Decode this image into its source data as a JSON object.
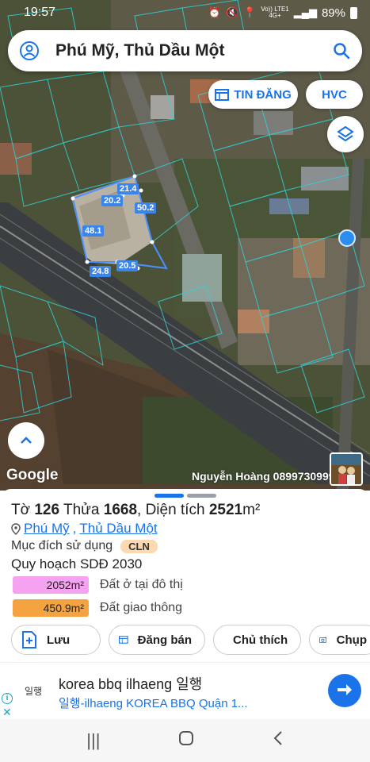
{
  "status_bar": {
    "time": "19:57",
    "network": "Vo)) LTE1",
    "signal": "4G+",
    "battery": "89%"
  },
  "search": {
    "title": "Phú Mỹ, Thủ Dầu Một"
  },
  "chips": {
    "tin_dang": "TIN ĐĂNG",
    "hvc": "HVC"
  },
  "map": {
    "google_label": "Google",
    "agent_name": "Nguyễn Hoàng  0899730999",
    "plot_labels": [
      "21.4",
      "20.2",
      "50.2",
      "48.1",
      "20.5",
      "24.8"
    ]
  },
  "parcel": {
    "to_label": "Tờ",
    "to_value": "126",
    "thua_label": "Thửa",
    "thua_value": "1668",
    "area_label": ", Diện tích",
    "area_value": "2521",
    "area_unit": "m²",
    "ward": "Phú Mỹ",
    "separator": ",",
    "district": "Thủ Dầu Một",
    "purpose_label": "Mục đích sử dụng",
    "purpose_code": "CLN",
    "plan_label": "Quy hoạch SDĐ 2030",
    "zones": [
      {
        "value": "2052m²",
        "label": "Đất ở tại đô thị",
        "color": "#f5a3f0"
      },
      {
        "value": "450.9m²",
        "label": "Đất giao thông",
        "color": "#f4a340"
      }
    ]
  },
  "actions": [
    {
      "label": "Lưu"
    },
    {
      "label": "Đăng bán"
    },
    {
      "label": "Chủ thích"
    },
    {
      "label": "Chụp"
    }
  ],
  "ad": {
    "logo_text": "일행",
    "title": "korea bbq ilhaeng 일행",
    "subtitle": "일행-ilhaeng KOREA BBQ Quận 1..."
  },
  "colors": {
    "accent": "#1a73e8",
    "badge": "#fcd9b0"
  }
}
